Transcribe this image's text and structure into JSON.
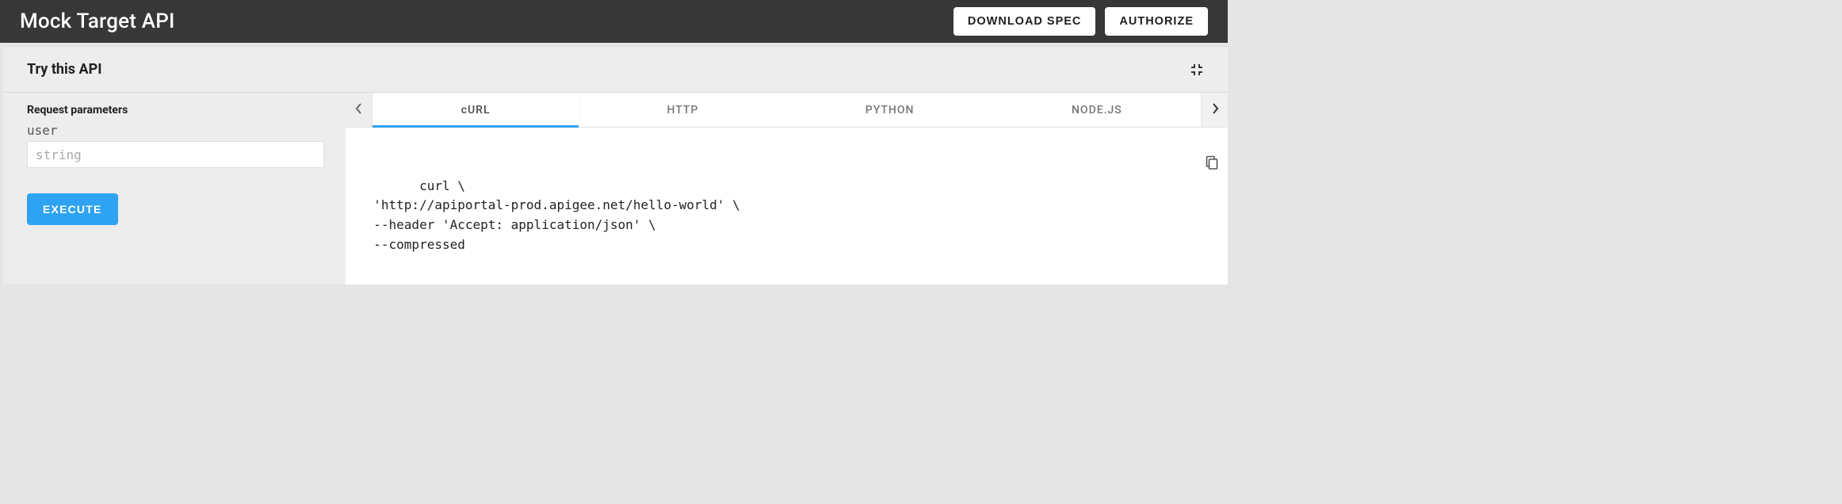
{
  "header": {
    "title": "Mock Target API",
    "download_label": "DOWNLOAD SPEC",
    "authorize_label": "AUTHORIZE"
  },
  "panel": {
    "title": "Try this API",
    "request_params_label": "Request parameters",
    "param_name": "user",
    "param_placeholder": "string",
    "execute_label": "EXECUTE"
  },
  "tabs": {
    "items": [
      {
        "label": "cURL",
        "active": true
      },
      {
        "label": "HTTP",
        "active": false
      },
      {
        "label": "PYTHON",
        "active": false
      },
      {
        "label": "NODE.JS",
        "active": false
      }
    ]
  },
  "code": "curl \\\n  'http://apiportal-prod.apigee.net/hello-world' \\\n  --header 'Accept: application/json' \\\n  --compressed"
}
